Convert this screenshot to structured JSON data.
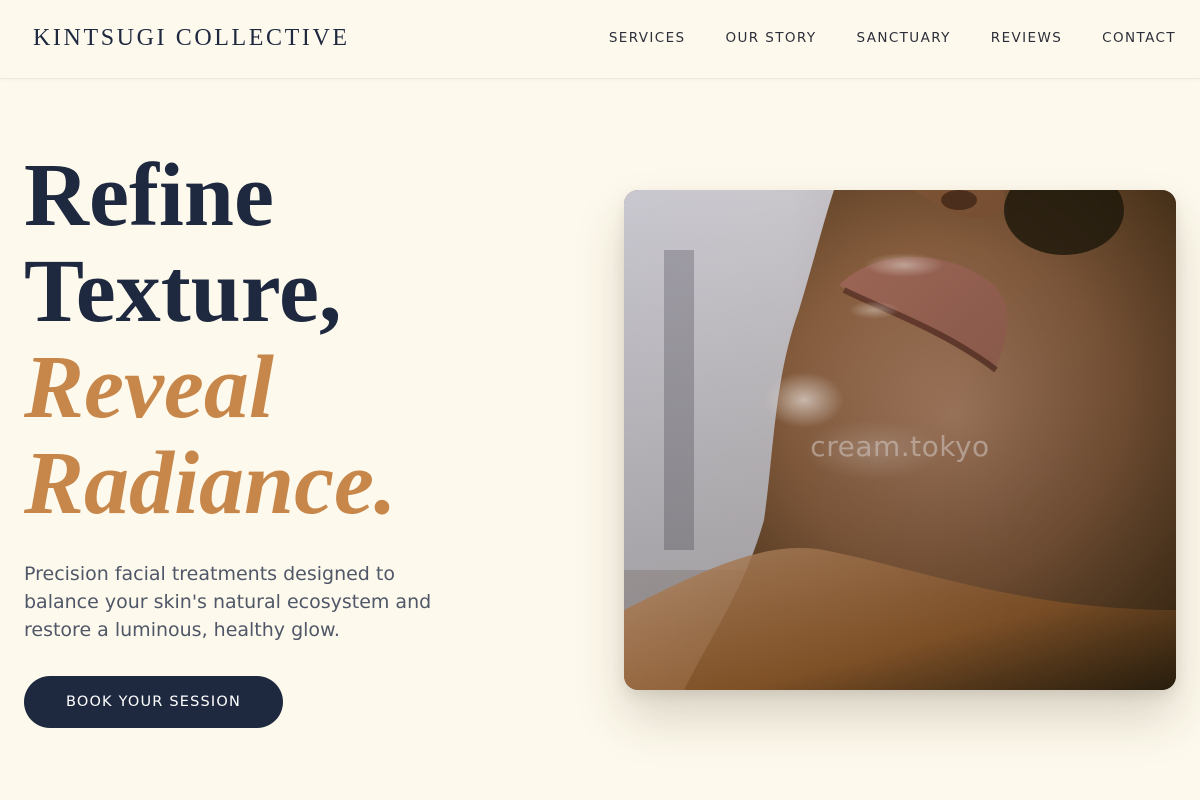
{
  "header": {
    "brand": "KINTSUGI COLLECTIVE",
    "nav": [
      {
        "label": "SERVICES"
      },
      {
        "label": "OUR STORY"
      },
      {
        "label": "SANCTUARY"
      },
      {
        "label": "REVIEWS"
      },
      {
        "label": "CONTACT"
      }
    ]
  },
  "hero": {
    "headline_line1": "Refine",
    "headline_line2": "Texture,",
    "headline_line3": "Reveal",
    "headline_line4": "Radiance.",
    "description": "Precision facial treatments designed to balance your skin's natural ecosystem and restore a luminous, healthy glow.",
    "cta_label": "BOOK YOUR SESSION",
    "image_watermark": "cream.tokyo"
  },
  "colors": {
    "background": "#fdf9ec",
    "navy": "#1e2940",
    "accent": "#c8874a",
    "body_text": "#4f5768"
  }
}
